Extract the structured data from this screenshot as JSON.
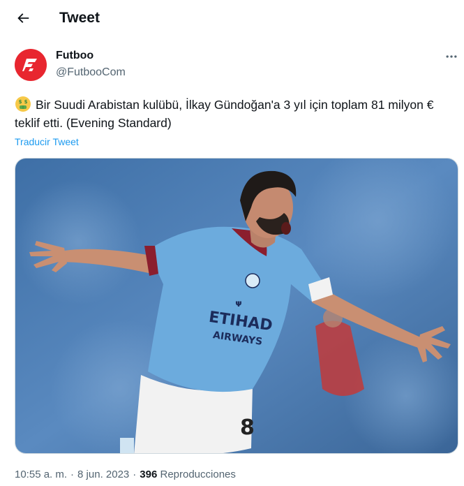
{
  "header": {
    "title": "Tweet"
  },
  "author": {
    "display_name": "Futboo",
    "handle": "@FutbooCom"
  },
  "tweet": {
    "emoji": "money-mouth-face",
    "text": "Bir Suudi Arabistan kulübü, İlkay Gündoğan'a 3 yıl için toplam 81 milyon € teklif etti. (Evening Standard)",
    "translate_label": "Traducir Tweet",
    "time": "10:55 a. m.",
    "separator": "·",
    "date": "8 jun. 2023",
    "views_count": "396",
    "views_label": "Reproducciones",
    "media_alt": "Football player in light blue Manchester City shirt celebrating with arms spread",
    "shirt_text_line1": "ETIHAD",
    "shirt_text_line2": "AIRWAYS",
    "shirt_number": "8"
  },
  "colors": {
    "brand": "#e8262f",
    "link": "#1d9bf0",
    "secondary_text": "#536471",
    "shirt": "#6cabdd"
  },
  "icons": {
    "back": "arrow-left-icon",
    "more": "more-horizontal-icon",
    "logo": "futboo-logo-icon"
  }
}
